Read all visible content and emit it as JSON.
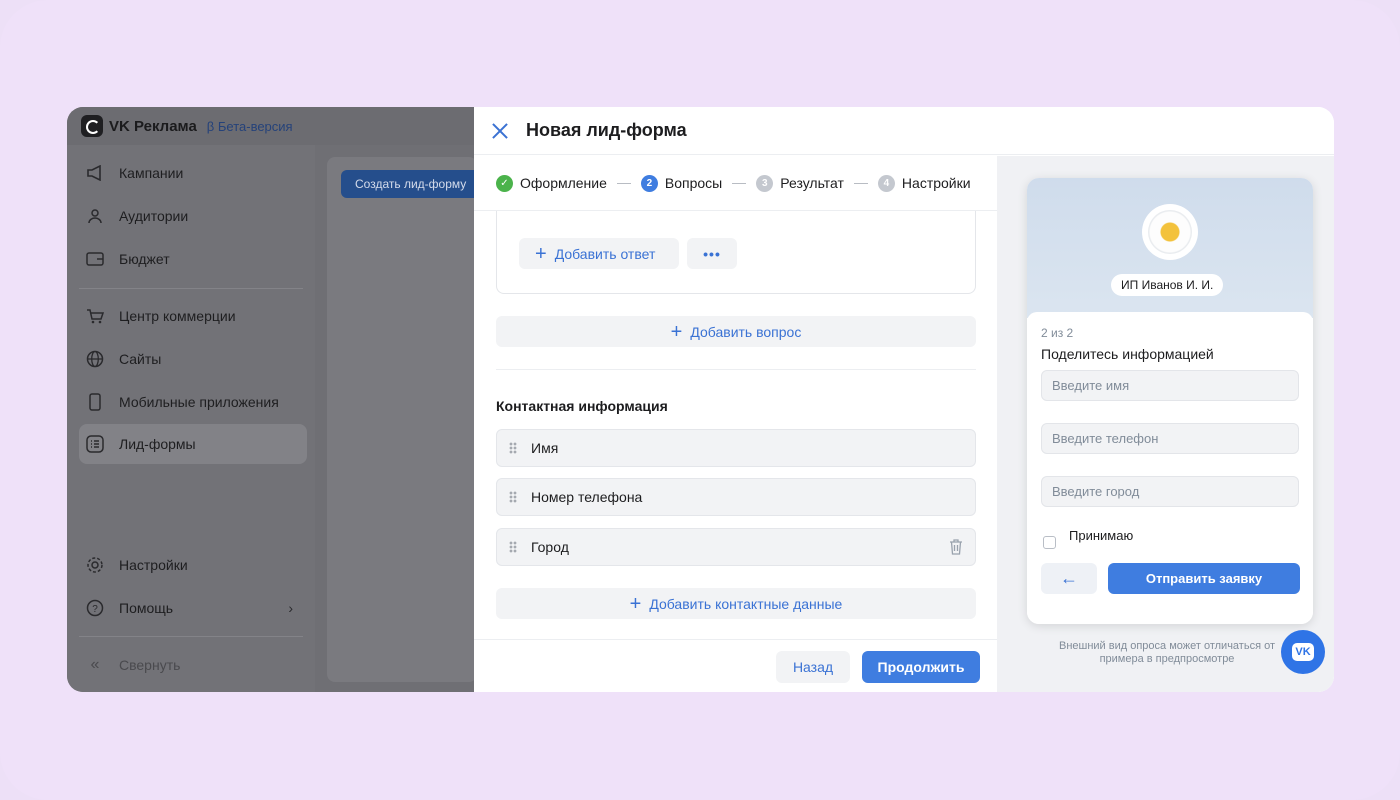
{
  "app": {
    "brand": "VK Реклама",
    "beta": "β Бета-версия",
    "create_button": "Создать лид-форму",
    "sidebar": {
      "items": [
        {
          "label": "Кампании",
          "icon": "megaphone-icon"
        },
        {
          "label": "Аудитории",
          "icon": "users-icon"
        },
        {
          "label": "Бюджет",
          "icon": "wallet-icon"
        },
        {
          "label": "Центр коммерции",
          "icon": "cart-icon"
        },
        {
          "label": "Сайты",
          "icon": "globe-icon"
        },
        {
          "label": "Мобильные приложения",
          "icon": "phone-icon"
        },
        {
          "label": "Лид-формы",
          "icon": "list-icon"
        }
      ],
      "bottom": [
        {
          "label": "Настройки",
          "icon": "gear-icon"
        },
        {
          "label": "Помощь",
          "icon": "help-icon"
        },
        {
          "label": "Свернуть",
          "icon": "collapse-icon"
        }
      ],
      "active": "Лид-формы"
    }
  },
  "modal": {
    "title": "Новая лид-форма",
    "steps": [
      {
        "num": "✓",
        "label": "Оформление",
        "state": "done"
      },
      {
        "num": "2",
        "label": "Вопросы",
        "state": "active"
      },
      {
        "num": "3",
        "label": "Результат",
        "state": "todo"
      },
      {
        "num": "4",
        "label": "Настройки",
        "state": "todo"
      }
    ],
    "add_answer": "Добавить ответ",
    "more": "•••",
    "add_question": "Добавить вопрос",
    "contact_title": "Контактная информация",
    "contact_fields": [
      "Имя",
      "Номер телефона",
      "Город"
    ],
    "add_contact": "Добавить контактные данные",
    "back": "Назад",
    "continue": "Продолжить"
  },
  "preview": {
    "owner": "ИП Иванов И. И.",
    "page": "2 из 2",
    "heading": "Поделитесь информацией",
    "inputs": [
      "Введите имя",
      "Введите телефон",
      "Введите город"
    ],
    "accept": "Принимаю",
    "back_arrow": "←",
    "submit": "Отправить заявку",
    "note": "Внешний вид опроса может отличаться от примера в предпросмотре",
    "fab": "VK"
  },
  "colors": {
    "accent": "#3f7de0",
    "done": "#4bb34b",
    "background": "#ede0f7"
  }
}
